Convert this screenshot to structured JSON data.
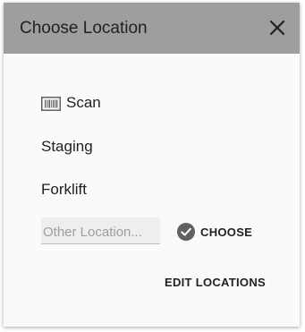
{
  "dialog": {
    "title": "Choose Location",
    "close_icon": "close-icon",
    "header_color": "#9e9e9e",
    "background_color": "#fafafa"
  },
  "options": {
    "scan": {
      "label": "Scan",
      "icon": "barcode-icon"
    },
    "staging": {
      "label": "Staging"
    },
    "forklift": {
      "label": "Forklift"
    }
  },
  "other_location": {
    "placeholder": "Other Location...",
    "value": ""
  },
  "choose_button": {
    "label": "CHOOSE",
    "icon": "check-circle-icon"
  },
  "edit_locations_button": {
    "label": "EDIT LOCATIONS"
  }
}
